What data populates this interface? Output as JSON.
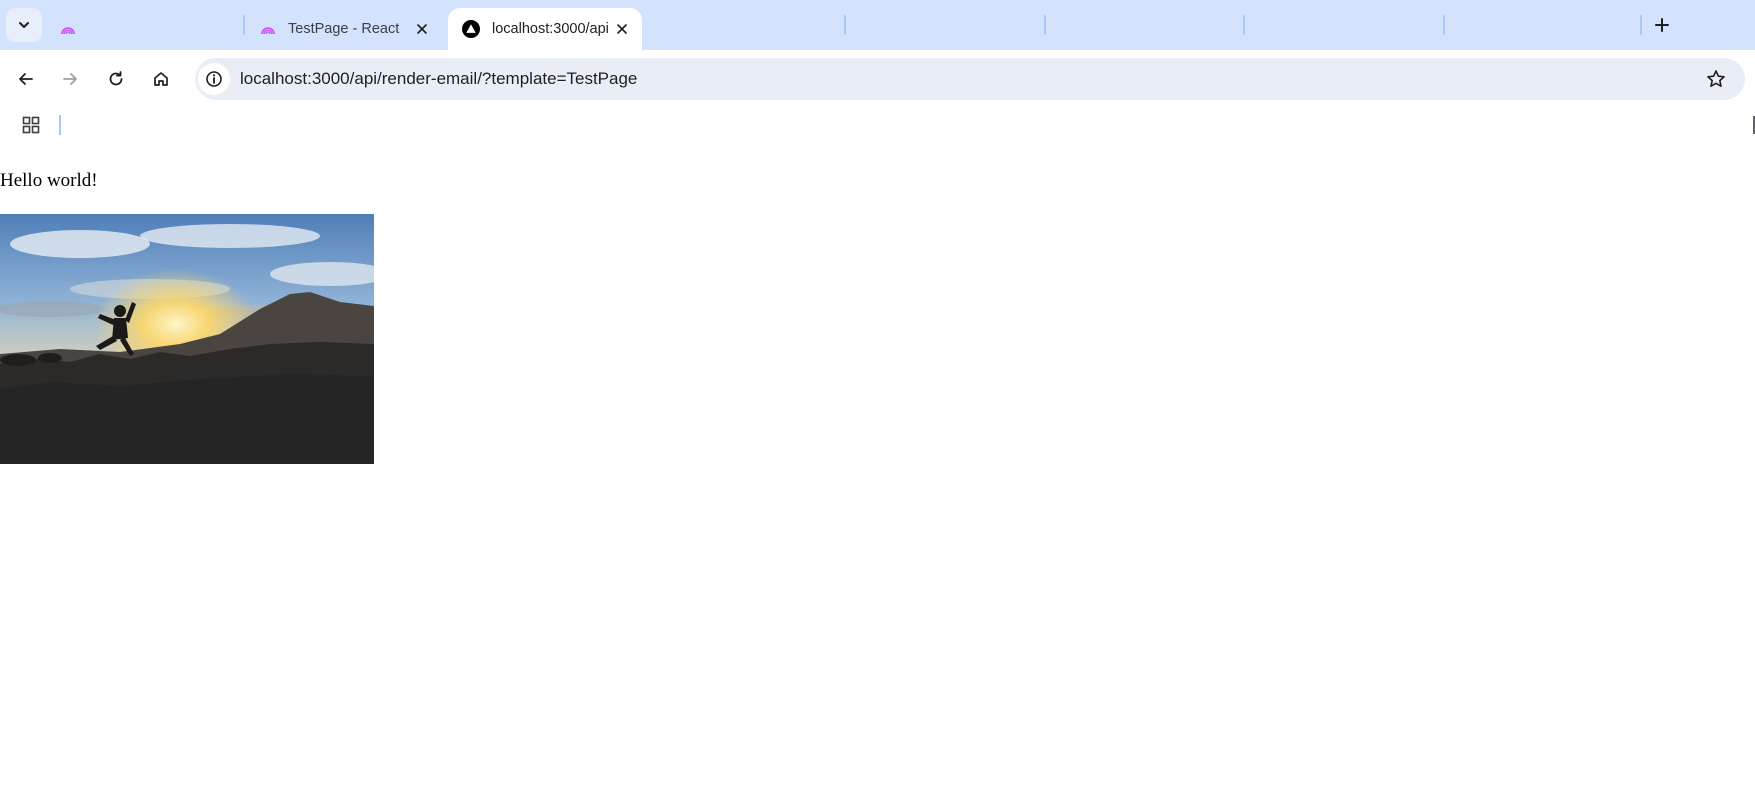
{
  "browser": {
    "tabs": [
      {
        "title": "",
        "favicon": "rainbow-arc-icon",
        "active": false
      },
      {
        "title": "TestPage - React",
        "favicon": "rainbow-arc-icon",
        "active": false
      },
      {
        "title": "localhost:3000/api",
        "favicon": "vercel-triangle-icon",
        "active": true
      }
    ],
    "address_bar": {
      "url": "localhost:3000/api/render-email/?template=TestPage"
    },
    "icons": {
      "tab_search": "chevron-down-icon",
      "new_tab": "plus-icon",
      "back": "arrow-left-icon",
      "forward": "arrow-right-icon",
      "reload": "reload-icon",
      "home": "home-icon",
      "site_info": "info-icon",
      "bookmark": "star-icon",
      "apps": "apps-grid-icon"
    },
    "colors": {
      "tabstrip": "#d3e3fd",
      "omnibox": "#e9eef6",
      "separator": "#a8c7fa"
    }
  },
  "page": {
    "heading": "Hello world!",
    "image_alt": "silhouette of a person jumping between rocks at sunset"
  }
}
